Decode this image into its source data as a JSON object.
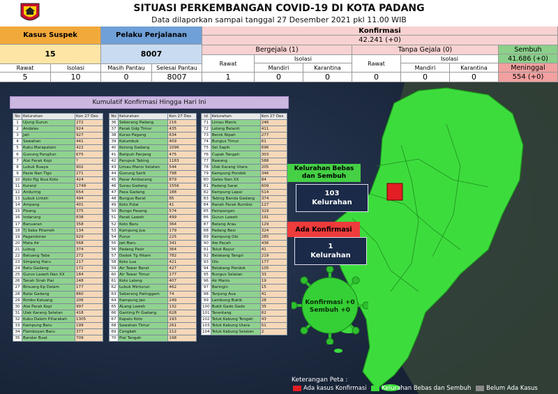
{
  "header": {
    "title": "SITUASI PERKEMBANGAN COVID-19 DI KOTA PADANG",
    "subtitle": "Data dilaporkan sampai tanggal 27 Desember 2021 pkl 11.00 WIB"
  },
  "suspek": {
    "label": "Kasus Suspek",
    "value": "15",
    "rawat_label": "Rawat",
    "rawat": "5",
    "isolasi_label": "Isolasi",
    "isolasi": "10"
  },
  "pelaku": {
    "label": "Pelaku Perjalanan",
    "value": "8007",
    "pantau_label": "Masih Pantau",
    "pantau": "0",
    "selesai_label": "Selesai Pantau",
    "selesai": "8007"
  },
  "konfirmasi": {
    "label": "Konfirmasi",
    "value": "42.241 (+0)",
    "bergejala": {
      "label": "Bergejala (1)",
      "rawat_label": "Rawat",
      "rawat": "1",
      "isolasi_label": "Isolasi",
      "mandiri_label": "Mandiri",
      "mandiri": "0",
      "karantina_label": "Karantina",
      "karantina": "0"
    },
    "tanpa": {
      "label": "Tanpa Gejala (0)",
      "rawat_label": "Rawat",
      "rawat": "0",
      "isolasi_label": "Isolasi",
      "mandiri_label": "Mandiri",
      "mandiri": "0",
      "karantina_label": "Karantina",
      "karantina": "0"
    },
    "sembuh_label": "Sembuh",
    "sembuh": "41.686 (+0)",
    "meninggal_label": "Meninggal",
    "meninggal": "554 (+0)"
  },
  "panel_title": "Kumulatif Konfirmasi Hingga Hari Ini",
  "table": {
    "col_no": "No",
    "col_id": "id",
    "col_kel": "Kelurahan",
    "col_val": "Kon 27 Des"
  },
  "rows": [
    [
      "1",
      "Ujung Gurun",
      "272"
    ],
    [
      "2",
      "Andalas",
      "924"
    ],
    [
      "3",
      "Jati",
      "927"
    ],
    [
      "4",
      "Sawahan",
      "441"
    ],
    [
      "5",
      "Kubu Marapalam",
      "422"
    ],
    [
      "6",
      "Gunung Pangilun",
      "675"
    ],
    [
      "7",
      "Alai Parak Kopi",
      "?"
    ],
    [
      "8",
      "Lubuk Buaya",
      "902"
    ],
    [
      "9",
      "Pasie Nan Tigo",
      "271"
    ],
    [
      "10",
      "Koto Pjg Ikua Koto",
      "424"
    ],
    [
      "11",
      "Kuranji",
      "1749"
    ],
    [
      "12",
      "Anduring",
      "654"
    ],
    [
      "13",
      "Lubuk Lintah",
      "494"
    ],
    [
      "14",
      "Ampang",
      "401"
    ],
    [
      "15",
      "Pisang",
      "375"
    ],
    [
      "16",
      "Indarung",
      "838"
    ],
    [
      "17",
      "Banuaran",
      "358"
    ],
    [
      "18",
      "Tj Saba Pitameh",
      "134"
    ],
    [
      "19",
      "Pagambiran",
      "929"
    ],
    [
      "20",
      "Mata Air",
      "568"
    ],
    [
      "21",
      "Lubug",
      "374"
    ],
    [
      "22",
      "Batuang Taba",
      "272"
    ],
    [
      "23",
      "Simpang Haru",
      "217"
    ],
    [
      "24",
      "Batu Gadang",
      "172"
    ],
    [
      "25",
      "Gurun Laweh Nan XX",
      "184"
    ],
    [
      "26",
      "Tanah Sirah Piai",
      "248"
    ],
    [
      "27",
      "Binuang Kp Dalam",
      "177"
    ],
    [
      "28",
      "Balai Gadang",
      "860"
    ],
    [
      "29",
      "Rimbo Kaluang",
      "206"
    ],
    [
      "30",
      "Alai Parak Kopi",
      "997"
    ],
    [
      "31",
      "Ulak Karang Selatan",
      "418"
    ],
    [
      "32",
      "Kubu Dalam P.Karakah",
      "1305"
    ],
    [
      "33",
      "Kampung Baru",
      "199"
    ],
    [
      "34",
      "Flamboyan Baru",
      "377"
    ],
    [
      "35",
      "Bandar Buat",
      "709"
    ],
    [
      "36",
      "Seberang Padang",
      "216"
    ],
    [
      "37",
      "Parak Gdg Timur",
      "435"
    ],
    [
      "38",
      "Kurao Pagang",
      "634"
    ],
    [
      "39",
      "Kalumbuk",
      "409"
    ],
    [
      "40",
      "Korong Gadang",
      "1096"
    ],
    [
      "41",
      "Batipuh Panjang",
      "475"
    ],
    [
      "42",
      "Parupuk Tabing",
      "1183"
    ],
    [
      "43",
      "Limau Manis Selatan",
      "544"
    ],
    [
      "44",
      "Gunung Sarik",
      "798"
    ],
    [
      "45",
      "Pasar Ambacang",
      "879"
    ],
    [
      "46",
      "Surau Gadang",
      "1556"
    ],
    [
      "47",
      "Pasa Gadang",
      "188"
    ],
    [
      "48",
      "Bungus Barat",
      "85"
    ],
    [
      "49",
      "Koto Pulai",
      "41"
    ],
    [
      "50",
      "Bungo Pasang",
      "574"
    ],
    [
      "51",
      "Parak Laweh",
      "499"
    ],
    [
      "52",
      "Koto Baru",
      "364"
    ],
    [
      "53",
      "Kampung Jua",
      "179"
    ],
    [
      "54",
      "Purus",
      "225"
    ],
    [
      "55",
      "Jati Baru",
      "341"
    ],
    [
      "56",
      "Padang Pasir",
      "364"
    ],
    [
      "57",
      "Dadok Tg Hitam",
      "782"
    ],
    [
      "58",
      "Koto Lua",
      "421"
    ],
    [
      "59",
      "Air Tawar Barat",
      "427"
    ],
    [
      "60",
      "Air Tawar Timur",
      "177"
    ],
    [
      "61",
      "Koto Lalang",
      "407"
    ],
    [
      "62",
      "Lubuk Minturun",
      "462"
    ],
    [
      "63",
      "Seberang Palinggam",
      "74"
    ],
    [
      "64",
      "Kampung Jao",
      "249"
    ],
    [
      "65",
      "ALang Laweh",
      "132"
    ],
    [
      "66",
      "Ganting Pr Gadang",
      "628"
    ],
    [
      "67",
      "Kapalo Koto",
      "193"
    ],
    [
      "68",
      "Sawahan Timur",
      "261"
    ],
    [
      "69",
      "Cengkeh",
      "212"
    ],
    [
      "70",
      "Pial Tangah",
      "198"
    ],
    [
      "71",
      "Limau Manis",
      "246"
    ],
    [
      "72",
      "Lolong Belanti",
      "411"
    ],
    [
      "73",
      "Berok Nipah",
      "277"
    ],
    [
      "74",
      "Bungus Timur",
      "61"
    ],
    [
      "75",
      "Sei Sapih",
      "696"
    ],
    [
      "76",
      "Cupak Tangah",
      "303"
    ],
    [
      "77",
      "Rawang",
      "588"
    ],
    [
      "78",
      "Ulak Karang Utara",
      "205"
    ],
    [
      "79",
      "Kampung Pondok",
      "346"
    ],
    [
      "80",
      "Gates Nan XX",
      "84"
    ],
    [
      "81",
      "Padang Sarai",
      "609"
    ],
    [
      "82",
      "Kampung Lapai",
      "514"
    ],
    [
      "83",
      "Tabing Banda Gadang",
      "374"
    ],
    [
      "84",
      "Ranah Parak Rumbio",
      "127"
    ],
    [
      "85",
      "Pampangan",
      "329"
    ],
    [
      "86",
      "Gurun Laweh",
      "191"
    ],
    [
      "87",
      "Batang Arau",
      "129"
    ],
    [
      "88",
      "Padang Besi",
      "324"
    ],
    [
      "89",
      "Kampung Olo",
      "285"
    ],
    [
      "90",
      "Aie Pacah",
      "436"
    ],
    [
      "91",
      "Teluk Bayur",
      "41"
    ],
    [
      "92",
      "Belakang Tangsi",
      "219"
    ],
    [
      "93",
      "Olo",
      "177"
    ],
    [
      "94",
      "Belakang Pondok",
      "105"
    ],
    [
      "95",
      "Bungus Selatan",
      "33"
    ],
    [
      "96",
      "Air Manis",
      "19"
    ],
    [
      "97",
      "Baringin",
      "15"
    ],
    [
      "98",
      "Tanjung Aua",
      "41"
    ],
    [
      "99",
      "Lambung Bukik",
      "28"
    ],
    [
      "100",
      "Bukit Gado Gado",
      "35"
    ],
    [
      "101",
      "Tarantang",
      "62"
    ],
    [
      "102",
      "Teluk Kabung Tengah",
      "43"
    ],
    [
      "103",
      "Teluk Kabung Utara",
      "51"
    ],
    [
      "104",
      "Teluk Kabung Selatan",
      "2"
    ]
  ],
  "boxes": {
    "bebas_label": "Kelurahan Bebas dan Sembuh",
    "bebas_value": "103",
    "bebas_unit": "Kelurahan",
    "ada_label": "Ada Konfirmasi",
    "ada_value": "1",
    "ada_unit": "Kelurahan",
    "virus_text": "Konfirmasi +0\nSembuh +0"
  },
  "legend": {
    "title": "Keterangan Peta :",
    "item1": "Ada kasus Konfirmasi",
    "item2": "Kelurahan Bebas dan Sembuh",
    "item3": "Belum Ada Kasus",
    "color1": "#e31e24",
    "color2": "#3ddc3d",
    "color3": "#8a8a8a"
  }
}
